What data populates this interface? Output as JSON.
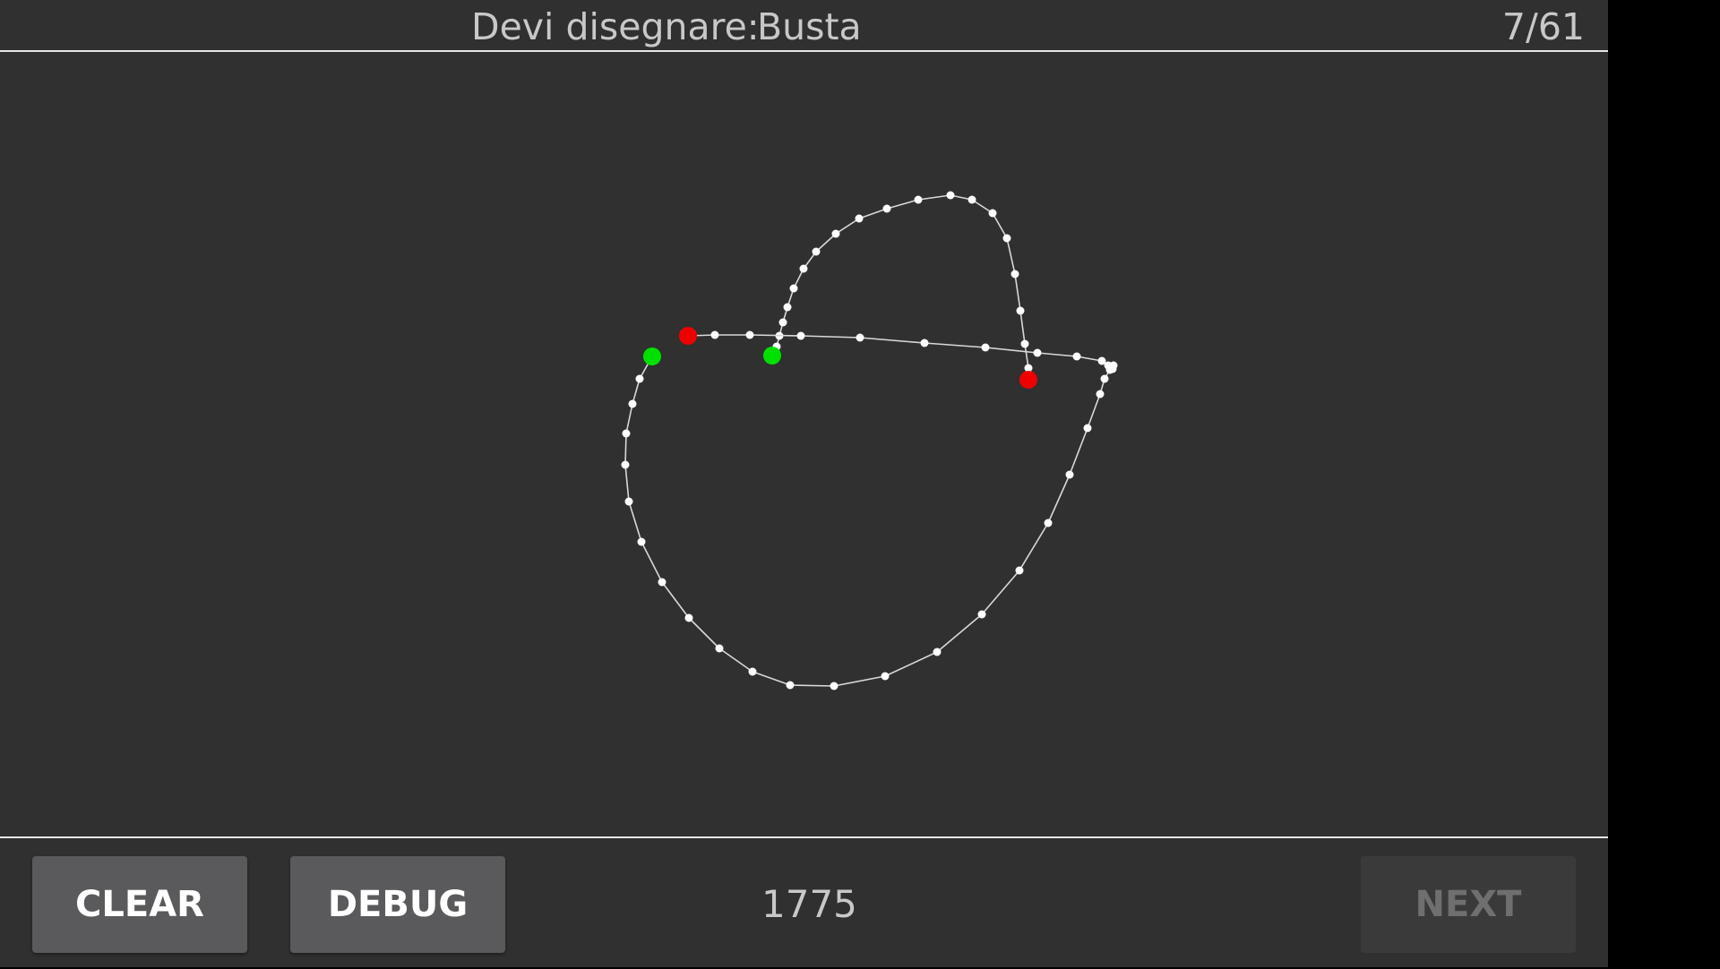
{
  "header": {
    "prompt_label": "Devi disegnare:",
    "prompt_word": "Busta",
    "progress": "7/61"
  },
  "footer": {
    "clear_label": "CLEAR",
    "debug_label": "DEBUG",
    "score": "1775",
    "next_label": "NEXT"
  },
  "drawing": {
    "stroke_color": "#d8d8d8",
    "point_color": "#ffffff",
    "start_marker_color": "#00e000",
    "end_marker_color": "#ee0000"
  }
}
